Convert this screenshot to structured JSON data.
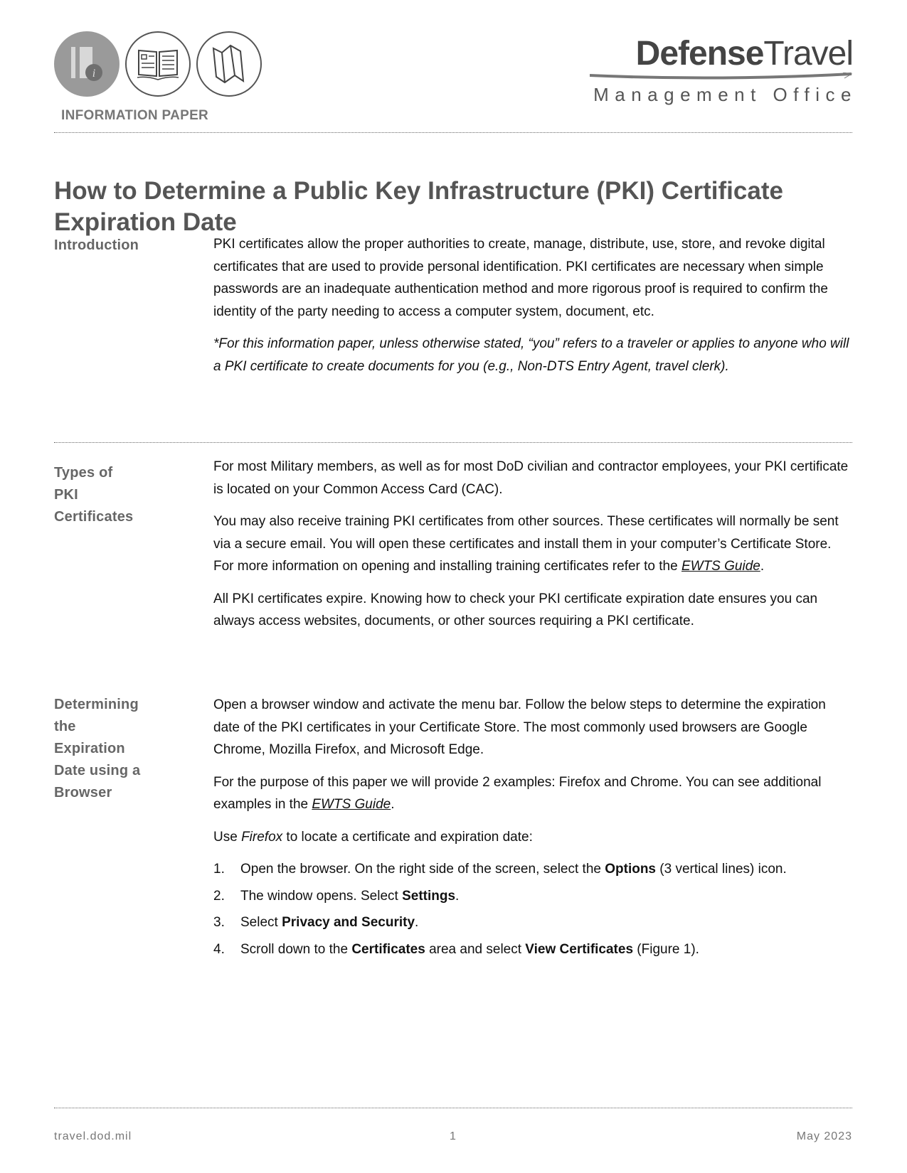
{
  "header": {
    "icons": [
      "information-icon",
      "open-book-icon",
      "folded-map-icon"
    ],
    "doc_type": "INFORMATION PAPER",
    "brand": {
      "name_bold": "Defense",
      "name_light": "Travel",
      "subtitle": "Management Office"
    }
  },
  "title": "How to Determine a Public Key Infrastructure (PKI) Certificate Expiration Date",
  "sections": {
    "introduction": {
      "label": "Introduction",
      "p1": "PKI certificates allow the proper authorities to create, manage, distribute, use, store, and revoke digital certificates that are used to provide personal identification. PKI certificates are necessary when simple passwords are an inadequate authentication method and more rigorous proof is required to confirm the identity of the party needing to access a computer system, document, etc.",
      "note": "*For this information paper, unless otherwise stated, “you” refers to a traveler or applies to anyone who will a PKI certificate to create documents for you (e.g., Non-DTS Entry Agent, travel clerk)."
    },
    "types": {
      "label_lines": [
        "Types of",
        "PKI",
        "Certificates"
      ],
      "p1": "For most Military members, as well as for most DoD civilian and contractor employees, your PKI certificate is located on your Common Access Card (CAC).",
      "p2_before": "You may also receive training PKI certificates from other sources. These certificates will normally be sent via a secure email. You will open these certificates and install them in your computer’s Certificate Store. For more information on opening and installing training certificates refer to the ",
      "p2_link": "EWTS Guide",
      "p2_after": ".",
      "p3": "All PKI certificates expire. Knowing how to check your PKI certificate expiration date ensures you can always access websites, documents, or other sources requiring a PKI certificate."
    },
    "determining": {
      "label_lines": [
        "Determining",
        "the",
        "Expiration",
        "Date using a",
        "Browser"
      ],
      "p1": "Open a browser window and activate the menu bar. Follow the below steps to determine the expiration date of the PKI certificates in your Certificate Store. The most commonly used browsers are Google Chrome, Mozilla Firefox, and Microsoft Edge.",
      "p2_before": "For the purpose of this paper we will provide 2 examples: Firefox and Chrome. You can see additional examples in the ",
      "p2_link": "EWTS Guide",
      "p2_after": ".",
      "p3_before": "Use ",
      "p3_em": "Firefox",
      "p3_after": " to locate a certificate and expiration date:",
      "steps": [
        {
          "num": "1.",
          "before": "Open the browser. On the right side of the screen, select the ",
          "bold": "Options",
          "after": " (3 vertical lines) icon."
        },
        {
          "num": "2.",
          "before": "The window opens. Select ",
          "bold": "Settings",
          "after": "."
        },
        {
          "num": "3.",
          "before": "Select ",
          "bold": "Privacy and Security",
          "after": "."
        },
        {
          "num": "4.",
          "before": "Scroll down to the ",
          "bold": "Certificates",
          "after": " area and select ",
          "bold2": "View Certificates",
          "after2": " (Figure 1)."
        }
      ]
    }
  },
  "footer": {
    "left": "travel.dod.mil",
    "center": "1",
    "right": "May 2023"
  }
}
